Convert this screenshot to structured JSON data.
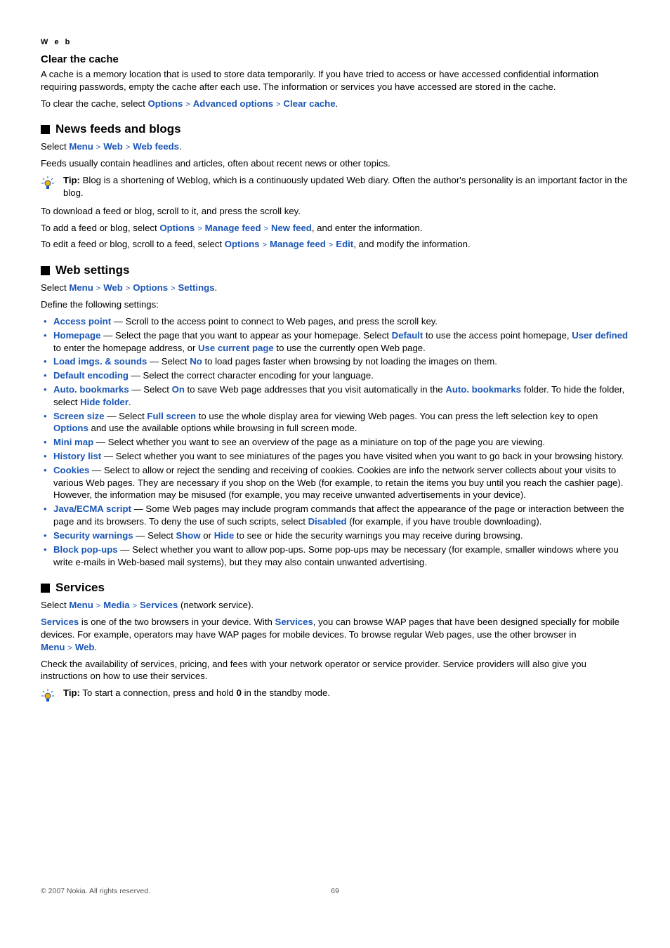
{
  "category": "W e b",
  "s1": {
    "title": "Clear the cache",
    "p1": "A cache is a memory location that is used to store data temporarily. If you have tried to access or have accessed confidential information requiring passwords, empty the cache after each use. The information or services you have accessed are stored in the cache.",
    "p2_pre": "To clear the cache, select ",
    "bc": [
      "Options",
      "Advanced options",
      "Clear cache"
    ]
  },
  "s2": {
    "title": "News feeds and blogs",
    "select_pre": "Select ",
    "bc": [
      "Menu",
      "Web",
      "Web feeds"
    ],
    "p_feeds": "Feeds usually contain headlines and articles, often about recent news or other topics.",
    "tip_label": "Tip:",
    "tip_body": " Blog is a shortening of Weblog, which is a continuously updated Web diary. Often the author's personality is an important factor in the blog.",
    "p_download": "To download a feed or blog, scroll to it, and press the scroll key.",
    "p_add_pre": "To add a feed or blog, select ",
    "p_add_bc": [
      "Options",
      "Manage feed",
      "New feed"
    ],
    "p_add_post": ", and enter the information.",
    "p_edit_pre": "To edit a feed or blog, scroll to a feed, select ",
    "p_edit_bc": [
      "Options",
      "Manage feed",
      "Edit"
    ],
    "p_edit_post": ", and modify the information."
  },
  "s3": {
    "title": "Web settings",
    "select_pre": "Select ",
    "bc": [
      "Menu",
      "Web",
      "Options",
      "Settings"
    ],
    "p_define": "Define the following settings:",
    "items": {
      "ap_k": "Access point",
      "ap_v": " — Scroll to the access point to connect to Web pages, and press the scroll key.",
      "hp_k": "Homepage",
      "hp_t1": " — Select the page that you want to appear as your homepage. Select ",
      "hp_def": "Default",
      "hp_t2": " to use the access point homepage, ",
      "hp_ud": "User defined",
      "hp_t3": " to enter the homepage address, or ",
      "hp_cp": "Use current page",
      "hp_t4": " to use the currently open Web page.",
      "li_k": "Load imgs. & sounds",
      "li_t1": " — Select ",
      "li_no": "No",
      "li_t2": " to load pages faster when browsing by not loading the images on them.",
      "de_k": "Default encoding",
      "de_v": " — Select the correct character encoding for your language.",
      "ab_k": "Auto. bookmarks",
      "ab_t1": " — Select ",
      "ab_on": "On",
      "ab_t2": " to save Web page addresses that you visit automatically in the ",
      "ab_folder": "Auto. bookmarks",
      "ab_t3": " folder. To hide the folder, select ",
      "ab_hide": "Hide folder",
      "ab_t4": ".",
      "ss_k": "Screen size",
      "ss_t1": " — Select ",
      "ss_fs": "Full screen",
      "ss_t2": " to use the whole display area for viewing Web pages. You can press the left selection key to open ",
      "ss_opt": "Options",
      "ss_t3": " and use the available options while browsing in full screen mode.",
      "mm_k": "Mini map",
      "mm_v": " — Select whether you want to see an overview of the page as a miniature on top of the page you are viewing.",
      "hl_k": "History list",
      "hl_v": " — Select whether you want to see miniatures of the pages you have visited when you want to go back in your browsing history.",
      "ck_k": "Cookies",
      "ck_v": " — Select to allow or reject the sending and receiving of cookies. Cookies are info the network server collects about your visits to various Web pages. They are necessary if you shop on the Web (for example, to retain the items you buy until you reach the cashier page). However, the information may be misused (for example, you may receive unwanted advertisements in your device).",
      "je_k": "Java/ECMA script",
      "je_t1": " — Some Web pages may include program commands that affect the appearance of the page or interaction between the page and its browsers. To deny the use of such scripts, select ",
      "je_dis": "Disabled",
      "je_t2": " (for example, if you have trouble downloading).",
      "sw_k": "Security warnings",
      "sw_t1": " — Select ",
      "sw_show": "Show",
      "sw_or": " or ",
      "sw_hide": "Hide",
      "sw_t2": " to see or hide the security warnings you may receive during browsing.",
      "bp_k": "Block pop-ups",
      "bp_v": " — Select whether you want to allow pop-ups. Some pop-ups may be necessary (for example, smaller windows where you write e-mails in Web-based mail systems), but they may also contain unwanted advertising."
    }
  },
  "s4": {
    "title": "Services",
    "select_pre": "Select ",
    "bc": [
      "Menu",
      "Media",
      "Services"
    ],
    "select_post": " (network service).",
    "p1_a": "Services",
    "p1_b": " is one of the two browsers in your device. With ",
    "p1_c": "Services",
    "p1_d": ", you can browse WAP pages that have been designed specially for mobile devices. For example, operators may have WAP pages for mobile devices. To browse regular Web pages, use the other browser in ",
    "p1_bc": [
      "Menu",
      "Web"
    ],
    "p1_e": ".",
    "p2": "Check the availability of services, pricing, and fees with your network operator or service provider. Service providers will also give you instructions on how to use their services.",
    "tip_label": "Tip:",
    "tip_b1": " To start a connection, press and hold ",
    "tip_key": "0",
    "tip_b2": " in the standby mode."
  },
  "footer": {
    "copyright": "© 2007 Nokia. All rights reserved.",
    "page": "69"
  }
}
